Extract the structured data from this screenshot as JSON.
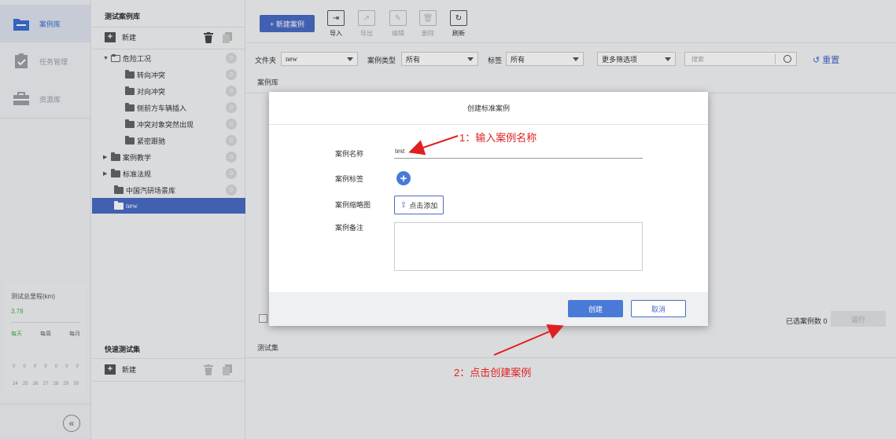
{
  "nav": {
    "items": [
      {
        "label": "案例库",
        "icon": "folder-icon"
      },
      {
        "label": "任务管理",
        "icon": "clipboard-icon"
      },
      {
        "label": "资源库",
        "icon": "briefcase-icon"
      }
    ],
    "mileage": {
      "title": "测试总里程(km)",
      "value": "3.78",
      "tabs": [
        "每天",
        "每周",
        "每月"
      ],
      "zeros": [
        "0",
        "0",
        "0",
        "0",
        "0",
        "0",
        "0"
      ],
      "days": [
        "24",
        "25",
        "26",
        "27",
        "28",
        "29",
        "30"
      ]
    },
    "collapse_icon": "double-chevron-left-icon"
  },
  "tree": {
    "header": "测试案例库",
    "new_label": "新建",
    "nodes": [
      {
        "label": "危险工况",
        "count": "0"
      },
      {
        "label": "转向冲突",
        "count": "0"
      },
      {
        "label": "对向冲突",
        "count": "0"
      },
      {
        "label": "侧前方车辆插入",
        "count": "0"
      },
      {
        "label": "冲突对象突然出现",
        "count": "0"
      },
      {
        "label": "紧密跟驰",
        "count": "0"
      },
      {
        "label": "案例教学",
        "count": "0"
      },
      {
        "label": "标准法规",
        "count": "0"
      },
      {
        "label": "中国汽研场景库",
        "count": "0"
      },
      {
        "label": "new",
        "count": ""
      }
    ],
    "quick_header": "快速测试集",
    "quick_new_label": "新建"
  },
  "toolbar": {
    "new_case": "+ 新建案例",
    "tools": [
      {
        "label": "导入",
        "icon": "import-icon",
        "glyph": "⇥"
      },
      {
        "label": "导出",
        "icon": "export-icon",
        "glyph": "↗"
      },
      {
        "label": "编辑",
        "icon": "edit-icon",
        "glyph": "✎"
      },
      {
        "label": "删除",
        "icon": "trash-icon",
        "glyph": "🗑"
      },
      {
        "label": "刷新",
        "icon": "refresh-icon",
        "glyph": "↻"
      }
    ]
  },
  "filters": {
    "folder_label": "文件夹",
    "folder_value": "new",
    "type_label": "案例类型",
    "type_value": "所有",
    "tag_label": "标签",
    "tag_value": "所有",
    "more_value": "更多筛选项",
    "search_placeholder": "搜索",
    "reset_label": "重置"
  },
  "list": {
    "section_label": "案例库",
    "selected_count": "已选案例数 0",
    "run_label": "运行",
    "testset_label": "测试集"
  },
  "modal": {
    "title": "创建标准案例",
    "name_label": "案例名称",
    "name_value": "test",
    "tag_label": "案例标签",
    "thumb_label": "案例缩略图",
    "upload_label": "点击添加",
    "remark_label": "案例备注",
    "create_label": "创建",
    "cancel_label": "取消"
  },
  "annotations": {
    "step1": "1：输入案例名称",
    "step2": "2：点击创建案例",
    "color": "#e02020"
  }
}
